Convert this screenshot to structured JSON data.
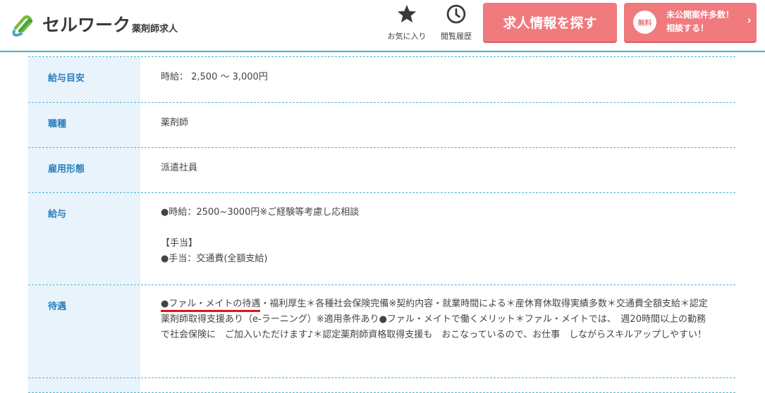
{
  "header": {
    "logo_main": "セルワーク",
    "logo_sub": "薬剤師求人",
    "favorite_label": "お気に入り",
    "history_label": "閲覧履歴",
    "search_button": "求人情報を探す",
    "consult_badge": "無料",
    "consult_line1": "未公開案件多数！",
    "consult_line2": "相談する！",
    "consult_arrow": "›"
  },
  "colors": {
    "accent": "#3fb8c8",
    "button": "#f07a7e",
    "label_text": "#2a7fbf",
    "label_bg": "#e9f3fb",
    "highlight": "#e0141e"
  },
  "rows": [
    {
      "label": "給与目安",
      "lines": [
        "時給： 2,500 ～ 3,000円"
      ]
    },
    {
      "label": "職種",
      "lines": [
        "薬剤師"
      ]
    },
    {
      "label": "雇用形態",
      "lines": [
        "派遣社員"
      ]
    },
    {
      "label": "給与",
      "lines": [
        "●時給：2500~3000円※ご経験等考慮し応相談",
        "【手当】",
        "●手当：交通費(全額支給)"
      ]
    },
    {
      "label": "待遇",
      "highlight": "●ファル・メイトの待遇",
      "rest": "・福利厚生＊各種社会保険完備※契約内容・就業時間による＊産休育休取得実績多数＊交通費全額支給＊認定薬剤師取得支援あり（e-ラーニング）※適用条件あり●ファル・メイトで働くメリット＊ファル・メイトでは、　週20時間以上の勤務で社会保険に　ご加入いただけます♪＊認定薬剤師資格取得支援も　おこなっているので、お仕事　しながらスキルアップしやすい！"
    }
  ]
}
